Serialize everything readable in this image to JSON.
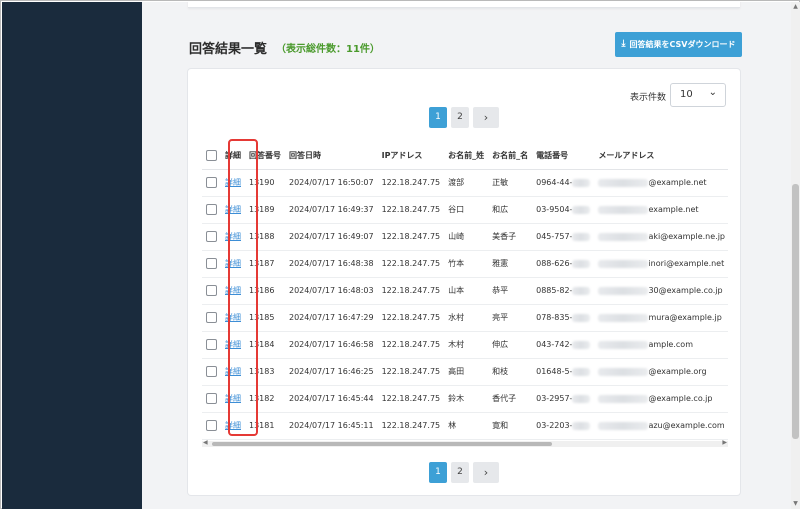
{
  "page": {
    "title": "回答結果一覧",
    "total_count": "（表示総件数：11件）",
    "csv_button": "回答結果をCSVダウンロード"
  },
  "per_page": {
    "label": "表示件数",
    "value": "10"
  },
  "pagination": {
    "pages": [
      "1",
      "2"
    ],
    "current": "1",
    "next": "›"
  },
  "table": {
    "headers": [
      "詳細",
      "回答番号",
      "回答日時",
      "IPアドレス",
      "お名前_姓",
      "お名前_名",
      "電話番号",
      "メールアドレス"
    ],
    "rows": [
      {
        "detail": "詳細",
        "id": "13190",
        "datetime": "2024/07/17 16:50:07",
        "ip": "122.18.247.75",
        "last": "渡部",
        "first": "正敏",
        "phone": "0964-44-",
        "email": "@example.net"
      },
      {
        "detail": "詳細",
        "id": "13189",
        "datetime": "2024/07/17 16:49:37",
        "ip": "122.18.247.75",
        "last": "谷口",
        "first": "和広",
        "phone": "03-9504-",
        "email": "example.net"
      },
      {
        "detail": "詳細",
        "id": "13188",
        "datetime": "2024/07/17 16:49:07",
        "ip": "122.18.247.75",
        "last": "山崎",
        "first": "美香子",
        "phone": "045-757-",
        "email": "aki@example.ne.jp"
      },
      {
        "detail": "詳細",
        "id": "13187",
        "datetime": "2024/07/17 16:48:38",
        "ip": "122.18.247.75",
        "last": "竹本",
        "first": "雅憲",
        "phone": "088-626-",
        "email": "inori@example.net"
      },
      {
        "detail": "詳細",
        "id": "13186",
        "datetime": "2024/07/17 16:48:03",
        "ip": "122.18.247.75",
        "last": "山本",
        "first": "恭平",
        "phone": "0885-82-",
        "email": "30@example.co.jp"
      },
      {
        "detail": "詳細",
        "id": "13185",
        "datetime": "2024/07/17 16:47:29",
        "ip": "122.18.247.75",
        "last": "水村",
        "first": "亮平",
        "phone": "078-835-",
        "email": "mura@example.jp"
      },
      {
        "detail": "詳細",
        "id": "13184",
        "datetime": "2024/07/17 16:46:58",
        "ip": "122.18.247.75",
        "last": "木村",
        "first": "伸広",
        "phone": "043-742-",
        "email": "ample.com"
      },
      {
        "detail": "詳細",
        "id": "13183",
        "datetime": "2024/07/17 16:46:25",
        "ip": "122.18.247.75",
        "last": "高田",
        "first": "和枝",
        "phone": "01648-5-",
        "email": "@example.org"
      },
      {
        "detail": "詳細",
        "id": "13182",
        "datetime": "2024/07/17 16:45:44",
        "ip": "122.18.247.75",
        "last": "鈴木",
        "first": "香代子",
        "phone": "03-2957-",
        "email": "@example.co.jp"
      },
      {
        "detail": "詳細",
        "id": "13181",
        "datetime": "2024/07/17 16:45:11",
        "ip": "122.18.247.75",
        "last": "林",
        "first": "寛和",
        "phone": "03-2203-",
        "email": "azu@example.com"
      }
    ]
  },
  "colors": {
    "sidebar": "#1a2b3d",
    "accent": "#3da0d6",
    "count_green": "#4a9a2c",
    "highlight": "#e53935"
  },
  "icons": {
    "csv_button": "download-icon",
    "select": "chevron-down-icon",
    "next": "chevron-right-icon"
  }
}
